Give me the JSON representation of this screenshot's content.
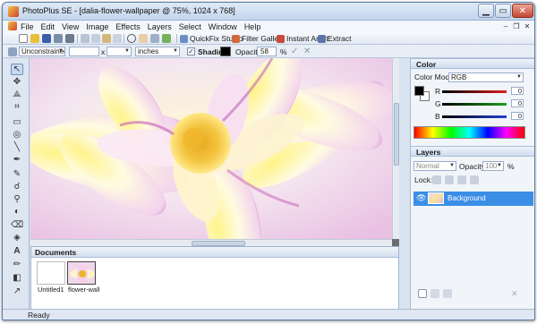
{
  "window": {
    "title": "PhotoPlus SE - [dalia-flower-wallpaper @ 75%, 1024 x 768]",
    "minimize_icon": "minimize-icon",
    "maximize_icon": "maximize-icon",
    "close_icon": "close-icon"
  },
  "menu": {
    "items": [
      "File",
      "Edit",
      "View",
      "Image",
      "Effects",
      "Layers",
      "Select",
      "Window",
      "Help"
    ]
  },
  "toolbar": {
    "quickfix_label": "QuickFix Studio",
    "filter_gallery_label": "Filter Gallery",
    "instant_artist_label": "Instant Artist",
    "extract_label": "Extract"
  },
  "context_bar": {
    "constraint_value": "Unconstrained",
    "width_value": "",
    "x_label": "x",
    "height_value": "",
    "units_value": "inches",
    "shading_label": "Shading",
    "shading_checked": "✓",
    "opacity_label": "Opacity:",
    "opacity_value": "58",
    "opacity_unit": "%",
    "apply_icon": "✓",
    "cancel_icon": "✕"
  },
  "documents_tab": {
    "title": "Documents",
    "docs": [
      {
        "label": "Untitled1"
      },
      {
        "label": "flower-wall"
      }
    ]
  },
  "color_panel": {
    "title": "Color",
    "mode_label": "Color Mode:",
    "mode_value": "RGB",
    "channels": [
      {
        "name": "R",
        "value": "0",
        "color": "#d32020"
      },
      {
        "name": "G",
        "value": "0",
        "color": "#22a322"
      },
      {
        "name": "B",
        "value": "0",
        "color": "#2442d0"
      }
    ]
  },
  "layers_panel": {
    "title": "Layers",
    "blend_mode": "Normal",
    "opacity_label": "Opacity:",
    "opacity_value": "100",
    "opacity_unit": "%",
    "lock_label": "Lock:",
    "layers": [
      {
        "name": "Background"
      }
    ]
  },
  "status": {
    "text": "Ready"
  }
}
